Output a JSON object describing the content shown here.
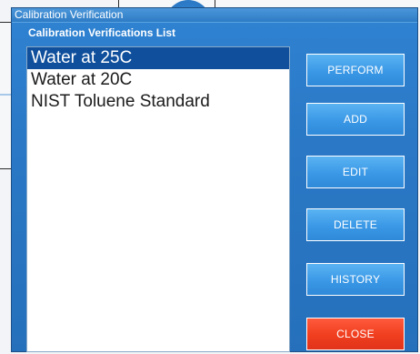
{
  "dialog": {
    "title": "Calibration Verification",
    "list_caption": "Calibration Verifications List"
  },
  "list": {
    "items": [
      {
        "label": "Water at 25C",
        "selected": true
      },
      {
        "label": "Water at 20C",
        "selected": false
      },
      {
        "label": "NIST Toluene Standard",
        "selected": false
      }
    ]
  },
  "buttons": {
    "perform": "PERFORM",
    "add": "ADD",
    "edit": "EDIT",
    "delete": "DELETE",
    "history": "HISTORY",
    "close": "CLOSE"
  },
  "colors": {
    "dialog_blue": "#2a78c6",
    "selection_blue": "#0f4f9c",
    "button_blue": "#3a98e6",
    "close_red": "#f03e1f"
  }
}
